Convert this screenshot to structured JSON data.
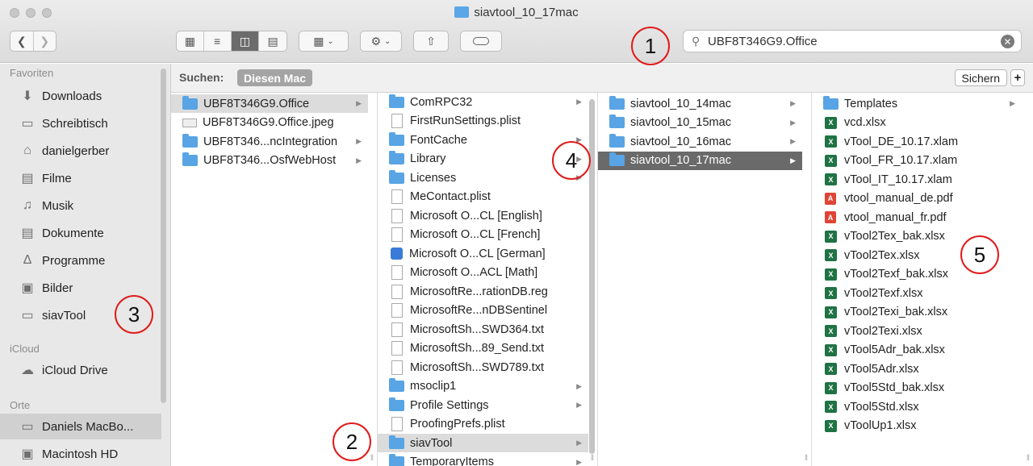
{
  "window": {
    "title": "siavtool_10_17mac"
  },
  "search": {
    "query": "UBF8T346G9.Office"
  },
  "searchbar": {
    "label": "Suchen:",
    "scope": "Diesen Mac",
    "save_label": "Sichern",
    "add_label": "+"
  },
  "sidebar": {
    "sections": [
      {
        "header": "Favoriten",
        "items": [
          {
            "label": "Downloads",
            "icon": "download-icon"
          },
          {
            "label": "Schreibtisch",
            "icon": "desktop-icon"
          },
          {
            "label": "danielgerber",
            "icon": "home-icon"
          },
          {
            "label": "Filme",
            "icon": "movies-icon"
          },
          {
            "label": "Musik",
            "icon": "music-icon"
          },
          {
            "label": "Dokumente",
            "icon": "documents-icon"
          },
          {
            "label": "Programme",
            "icon": "applications-icon"
          },
          {
            "label": "Bilder",
            "icon": "pictures-icon"
          },
          {
            "label": "siavTool",
            "icon": "folder-icon"
          }
        ]
      },
      {
        "header": "iCloud",
        "items": [
          {
            "label": "iCloud Drive",
            "icon": "cloud-icon"
          }
        ]
      },
      {
        "header": "Orte",
        "items": [
          {
            "label": "Daniels MacBo...",
            "icon": "laptop-icon"
          },
          {
            "label": "Macintosh HD",
            "icon": "disk-icon"
          }
        ]
      }
    ]
  },
  "columns": [
    [
      {
        "label": "UBF8T346G9.Office",
        "icon": "folder",
        "arrow": true,
        "sel": "grey"
      },
      {
        "label": "UBF8T346G9.Office.jpeg",
        "icon": "jpeg"
      },
      {
        "label": "UBF8T346...ncIntegration",
        "icon": "folder",
        "arrow": true
      },
      {
        "label": "UBF8T346...OsfWebHost",
        "icon": "folder",
        "arrow": true
      }
    ],
    [
      {
        "label": "ComRPC32",
        "icon": "folder",
        "arrow": true
      },
      {
        "label": "FirstRunSettings.plist",
        "icon": "doc"
      },
      {
        "label": "FontCache",
        "icon": "folder",
        "arrow": true
      },
      {
        "label": "Library",
        "icon": "folder",
        "arrow": true
      },
      {
        "label": "Licenses",
        "icon": "folder",
        "arrow": true
      },
      {
        "label": "MeContact.plist",
        "icon": "doc"
      },
      {
        "label": "Microsoft O...CL [English]",
        "icon": "doc"
      },
      {
        "label": "Microsoft O...CL [French]",
        "icon": "doc"
      },
      {
        "label": "Microsoft O...CL [German]",
        "icon": "reg"
      },
      {
        "label": "Microsoft O...ACL [Math]",
        "icon": "doc"
      },
      {
        "label": "MicrosoftRe...rationDB.reg",
        "icon": "doc"
      },
      {
        "label": "MicrosoftRe...nDBSentinel",
        "icon": "doc"
      },
      {
        "label": "MicrosoftSh...SWD364.txt",
        "icon": "doc"
      },
      {
        "label": "MicrosoftSh...89_Send.txt",
        "icon": "doc"
      },
      {
        "label": "MicrosoftSh...SWD789.txt",
        "icon": "doc"
      },
      {
        "label": "msoclip1",
        "icon": "folder",
        "arrow": true
      },
      {
        "label": "Profile Settings",
        "icon": "folder",
        "arrow": true
      },
      {
        "label": "ProofingPrefs.plist",
        "icon": "doc"
      },
      {
        "label": "siavTool",
        "icon": "folder",
        "arrow": true,
        "sel": "grey"
      },
      {
        "label": "TemporaryItems",
        "icon": "folder",
        "arrow": true
      }
    ],
    [
      {
        "label": "siavtool_10_14mac",
        "icon": "folder",
        "arrow": true
      },
      {
        "label": "siavtool_10_15mac",
        "icon": "folder",
        "arrow": true
      },
      {
        "label": "siavtool_10_16mac",
        "icon": "folder",
        "arrow": true
      },
      {
        "label": "siavtool_10_17mac",
        "icon": "folder",
        "arrow": true,
        "sel": "dark"
      }
    ],
    [
      {
        "label": "Templates",
        "icon": "folder",
        "arrow": true
      },
      {
        "label": "vcd.xlsx",
        "icon": "xlsx"
      },
      {
        "label": "vTool_DE_10.17.xlam",
        "icon": "xlsx"
      },
      {
        "label": "vTool_FR_10.17.xlam",
        "icon": "xlsx"
      },
      {
        "label": "vTool_IT_10.17.xlam",
        "icon": "xlsx"
      },
      {
        "label": "vtool_manual_de.pdf",
        "icon": "pdf"
      },
      {
        "label": "vtool_manual_fr.pdf",
        "icon": "pdf"
      },
      {
        "label": "vTool2Tex_bak.xlsx",
        "icon": "xlsx"
      },
      {
        "label": "vTool2Tex.xlsx",
        "icon": "xlsx"
      },
      {
        "label": "vTool2Texf_bak.xlsx",
        "icon": "xlsx"
      },
      {
        "label": "vTool2Texf.xlsx",
        "icon": "xlsx"
      },
      {
        "label": "vTool2Texi_bak.xlsx",
        "icon": "xlsx"
      },
      {
        "label": "vTool2Texi.xlsx",
        "icon": "xlsx"
      },
      {
        "label": "vTool5Adr_bak.xlsx",
        "icon": "xlsx"
      },
      {
        "label": "vTool5Adr.xlsx",
        "icon": "xlsx"
      },
      {
        "label": "vTool5Std_bak.xlsx",
        "icon": "xlsx"
      },
      {
        "label": "vTool5Std.xlsx",
        "icon": "xlsx"
      },
      {
        "label": "vToolUp1.xlsx",
        "icon": "xlsx"
      }
    ]
  ],
  "callouts": [
    "1",
    "2",
    "3",
    "4",
    "5"
  ]
}
